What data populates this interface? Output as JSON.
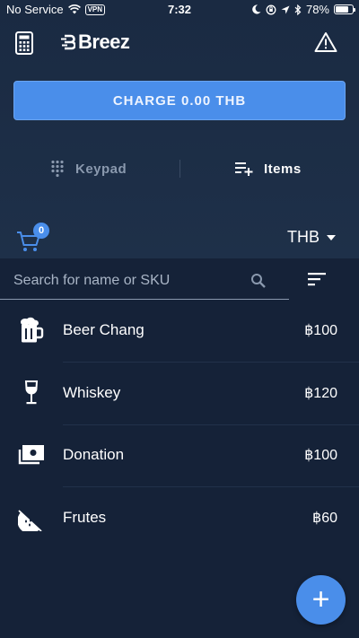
{
  "status_bar": {
    "carrier": "No Service",
    "vpn": "VPN",
    "time": "7:32",
    "battery": "78%",
    "battery_level": 0.78
  },
  "header": {
    "brand": "Breez",
    "icons": {
      "left": "calculator-icon",
      "right": "warning-icon"
    }
  },
  "charge": {
    "label": "CHARGE 0.00 THB"
  },
  "tabs": [
    {
      "label": "Keypad",
      "icon": "keypad-icon",
      "active": false
    },
    {
      "label": "Items",
      "icon": "playlist-add-icon",
      "active": true
    }
  ],
  "cart": {
    "count": "0"
  },
  "currency": {
    "label": "THB"
  },
  "search": {
    "placeholder": "Search for name or SKU",
    "value": ""
  },
  "items": [
    {
      "name": "Beer Chang",
      "price": "฿100",
      "icon": "beer-icon"
    },
    {
      "name": "Whiskey",
      "price": "฿120",
      "icon": "wine-glass-icon"
    },
    {
      "name": "Donation",
      "price": "฿100",
      "icon": "money-icon"
    },
    {
      "name": "Frutes",
      "price": "฿60",
      "icon": "watermelon-icon"
    }
  ],
  "fab": {
    "label": "+"
  },
  "colors": {
    "accent": "#4a8eea",
    "background": "#1b2b44",
    "list_background": "#152238"
  }
}
